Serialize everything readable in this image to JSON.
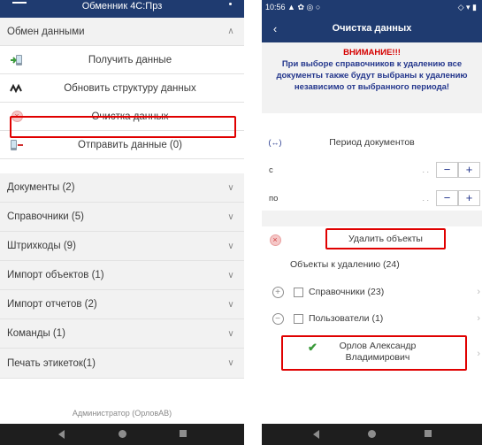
{
  "left": {
    "topbar_title": "Обменник 4С:Прз",
    "exchange_section": {
      "label": "Обмен данными"
    },
    "items": [
      {
        "label": "Получить данные"
      },
      {
        "label": "Обновить структуру данных"
      },
      {
        "label": "Очистка данных"
      },
      {
        "label": "Отправить данные (0)"
      }
    ],
    "sections": [
      {
        "label": "Документы (2)"
      },
      {
        "label": "Справочники (5)"
      },
      {
        "label": "Штрихкоды (9)"
      },
      {
        "label": "Импорт объектов (1)"
      },
      {
        "label": "Импорт отчетов (2)"
      },
      {
        "label": "Команды (1)"
      },
      {
        "label": "Печать этикеток(1)"
      }
    ],
    "footer": "Администратор (ОрловАВ)"
  },
  "right": {
    "status_time": "10:56",
    "title": "Очистка данных",
    "warning_title": "ВНИМАНИЕ!!!",
    "warning_text": "При выборе справочников к удалению все документы также будут выбраны к удалению независимо от выбранного периода!",
    "period_label": "Период документов",
    "from_label": "с",
    "to_label": "по",
    "date_placeholder": ". .",
    "minus": "−",
    "plus": "+",
    "delete_button": "Удалить объекты",
    "objects_label": "Объекты к удалению (24)",
    "tree": [
      {
        "label": "Справочники (23)",
        "expander": "+"
      },
      {
        "label": "Пользователи (1)",
        "expander": "−"
      }
    ],
    "selected_item": "Орлов Александр Владимирович"
  },
  "colors": {
    "header": "#1f3b70",
    "accent": "#23368c",
    "highlight": "#e00000"
  }
}
